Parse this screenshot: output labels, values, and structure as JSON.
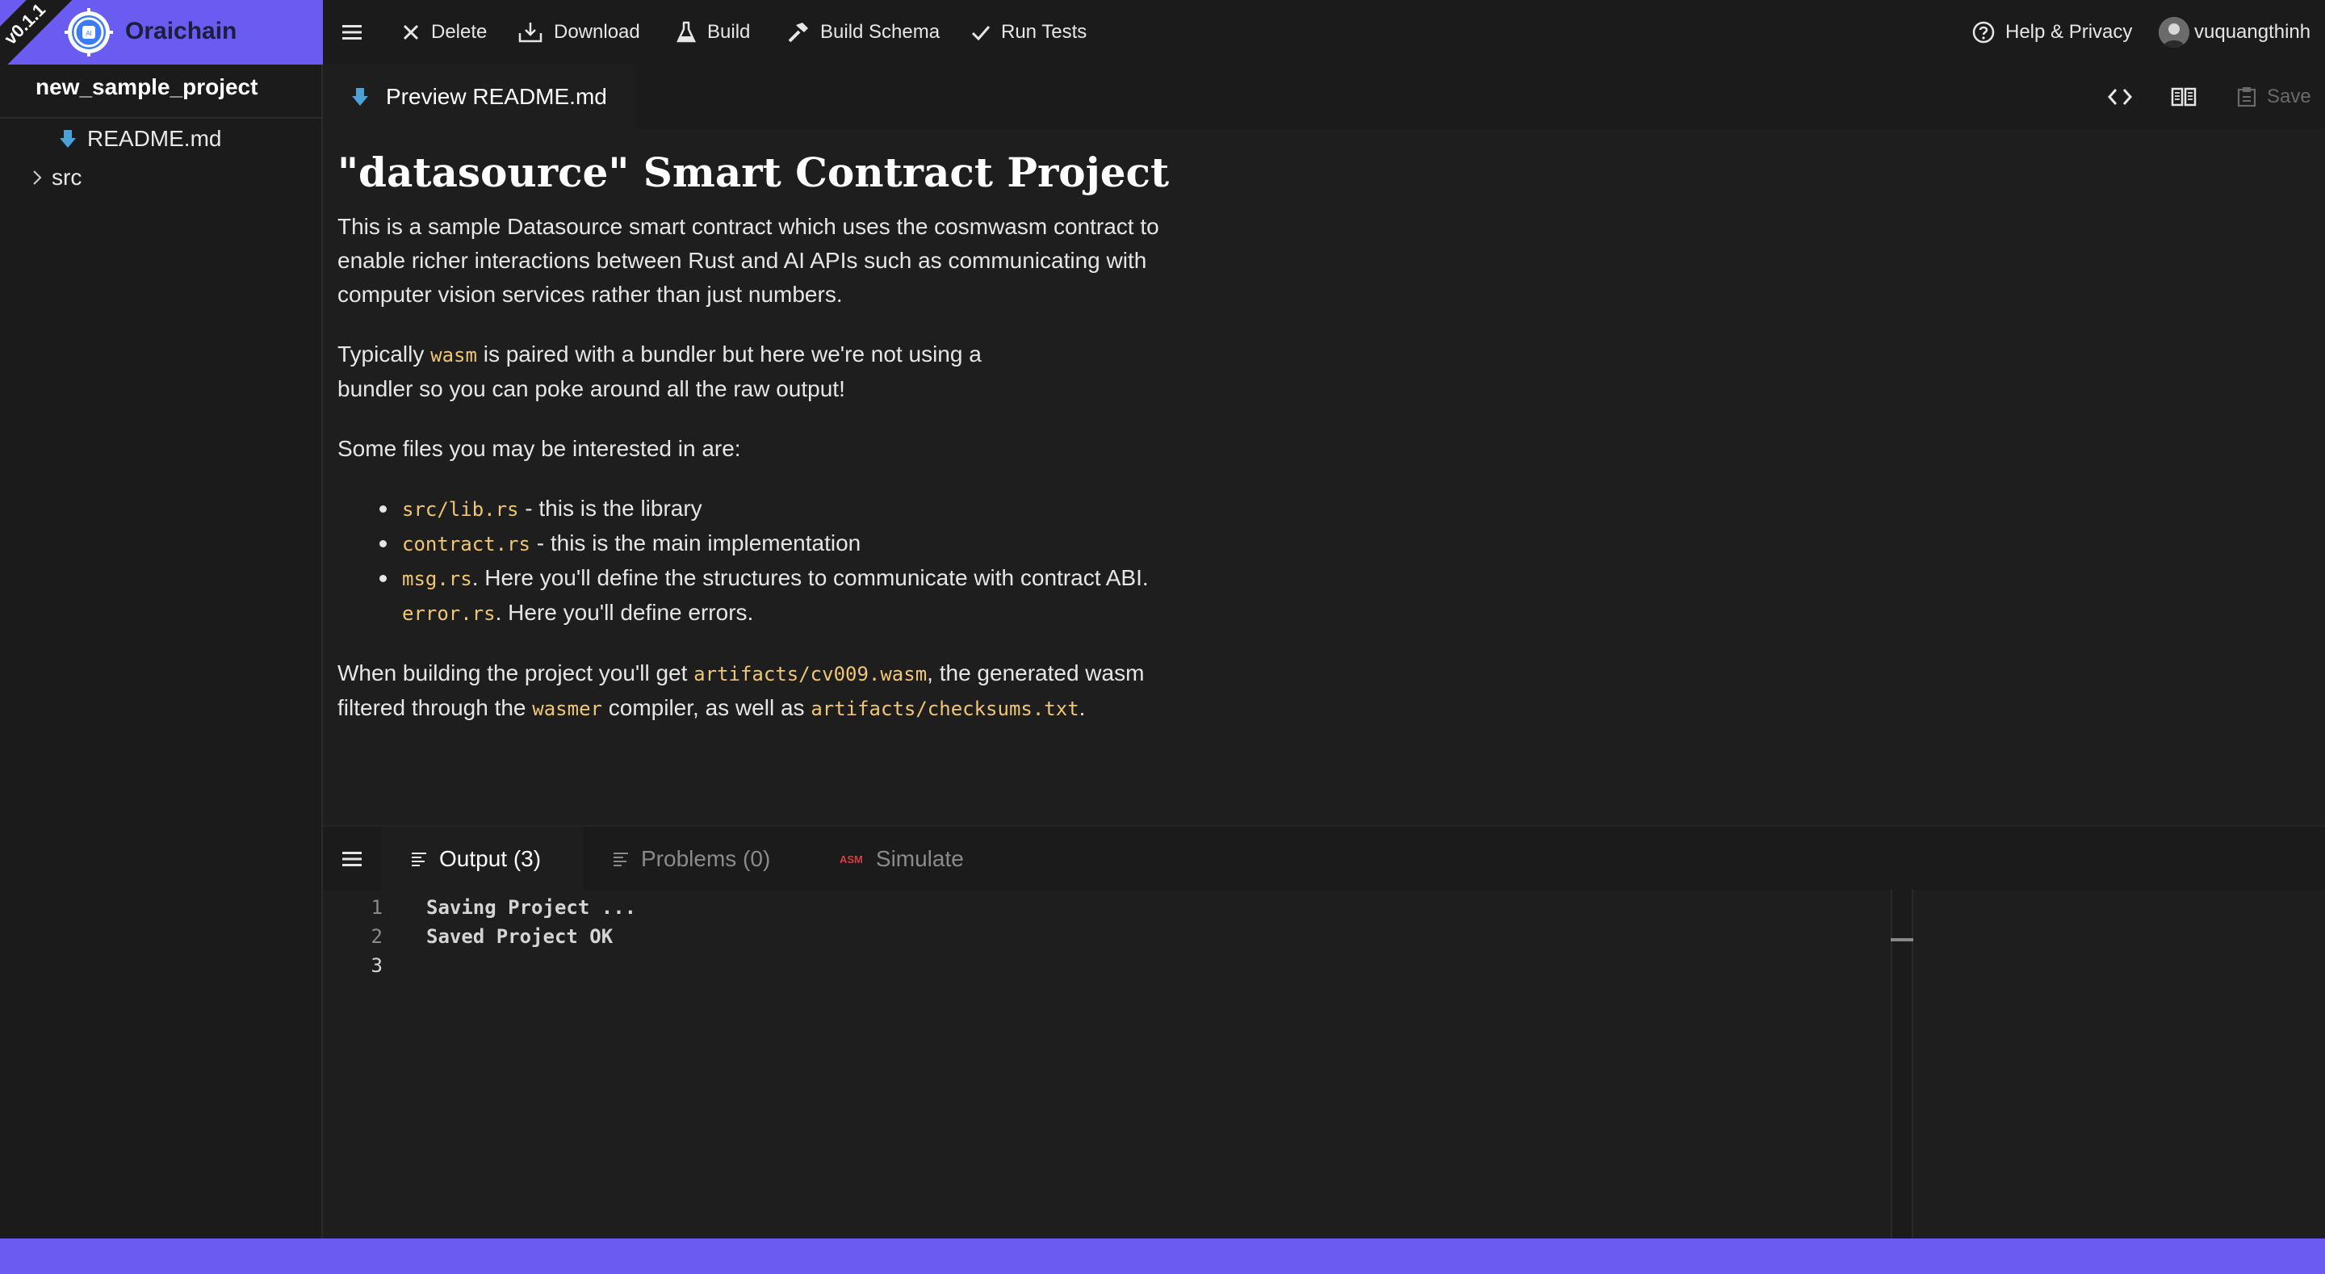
{
  "brand": {
    "version": "v0.1.1",
    "name": "Oraichain"
  },
  "sidebar": {
    "project_name": "new_sample_project",
    "tree": [
      {
        "label": "README.md",
        "icon": "markdown-icon"
      },
      {
        "label": "src",
        "icon": "chevron-right-icon"
      }
    ]
  },
  "toolbar": {
    "delete_label": "Delete",
    "download_label": "Download",
    "build_label": "Build",
    "build_schema_label": "Build Schema",
    "run_tests_label": "Run Tests",
    "help_label": "Help & Privacy",
    "username": "vuquangthinh"
  },
  "editor": {
    "active_tab": "Preview README.md",
    "save_label": "Save"
  },
  "readme": {
    "title": "\"datasource\" Smart Contract Project",
    "p1": "This is a sample Datasource smart contract which uses the cosmwasm contract to enable richer interactions between Rust and AI APIs such as communicating with computer vision services rather than just numbers.",
    "p2": {
      "before": "Typically ",
      "code": "wasm",
      "after_line1": " is paired with a bundler but here we're not using a",
      "line2": "bundler so you can poke around all the raw output!"
    },
    "p3": "Some files you may be interested in are:",
    "list": [
      {
        "code": "src/lib.rs",
        "text": " - this is the library"
      },
      {
        "code": "contract.rs",
        "text": " - this is the main implementation"
      },
      {
        "code": "msg.rs",
        "text": ". Here you'll define the structures to communicate with contract ABI."
      },
      {
        "code": "error.rs",
        "text": ". Here you'll define errors."
      }
    ],
    "p4": {
      "t1": "When building the project you'll get ",
      "c1": "artifacts/cv009.wasm",
      "t2": ", the generated wasm",
      "t3": "filtered through the ",
      "c2": "wasmer",
      "t4": " compiler, as well as ",
      "c3": "artifacts/checksums.txt",
      "t5": "."
    }
  },
  "panel": {
    "tabs": [
      {
        "label": "Output (3)",
        "active": true
      },
      {
        "label": "Problems (0)",
        "active": false
      },
      {
        "label": "Simulate",
        "active": false,
        "badge": "ASM"
      }
    ],
    "output_lines": [
      {
        "number": "1",
        "text": "Saving Project ..."
      },
      {
        "number": "2",
        "text": "Saved Project OK"
      },
      {
        "number": "3",
        "text": ""
      }
    ]
  },
  "colors": {
    "brand": "#6a5cf0",
    "background": "#1e1e1e",
    "code_text": "#f0c674"
  }
}
